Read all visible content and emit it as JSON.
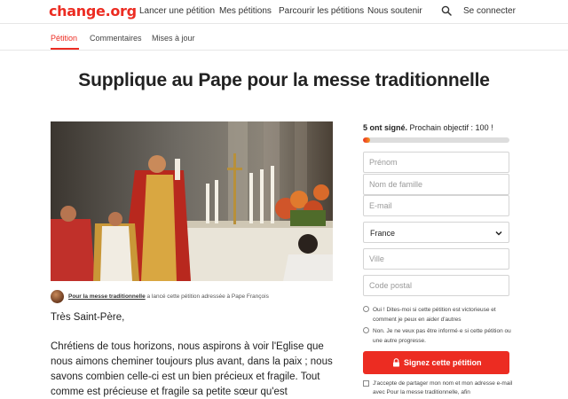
{
  "nav": {
    "logo": "change.org",
    "links": [
      "Lancer une pétition",
      "Mes pétitions",
      "Parcourir les pétitions",
      "Nous soutenir"
    ],
    "login": "Se connecter"
  },
  "tabs": [
    "Pétition",
    "Commentaires",
    "Mises à jour"
  ],
  "petition": {
    "title": "Supplique au Pape pour la messe traditionnelle",
    "author_link": "Pour la messe traditionnelle",
    "author_rest": " a lancé cette pétition adressée à Pape François",
    "salutation": "Très Saint-Père,",
    "body": "Chrétiens de tous horizons, nous aspirons à voir l'Eglise que nous aimons cheminer toujours plus avant, dans la paix ; nous savons combien celle-ci est un bien précieux et fragile. Tout comme est précieuse et fragile sa petite sœur qu'est"
  },
  "signatures": {
    "count_text": "5 ont signé.",
    "goal_text": " Prochain objectif : 100 !",
    "progress_fraction": 0.05
  },
  "form": {
    "first_name_placeholder": "Prénom",
    "last_name_placeholder": "Nom de famille",
    "email_placeholder": "E-mail",
    "country_value": "France",
    "city_placeholder": "Ville",
    "postal_placeholder": "Code postal",
    "radio_yes": "Oui ! Dites-moi si cette pétition est victorieuse et comment je peux en aider d'autres",
    "radio_no": "Non. Je ne veux pas être informé·e si cette pétition ou une autre progresse.",
    "sign_button": "Signez cette pétition",
    "consent": "J'accepte de partager mon nom et mon adresse e-mail avec Pour la messe traditionnelle, afin"
  },
  "colors": {
    "brand": "#ec2c22",
    "progress_end": "#f39a1f"
  },
  "icons": {
    "search": "search-icon",
    "chevron": "chevron-down-icon",
    "lock": "lock-icon"
  }
}
